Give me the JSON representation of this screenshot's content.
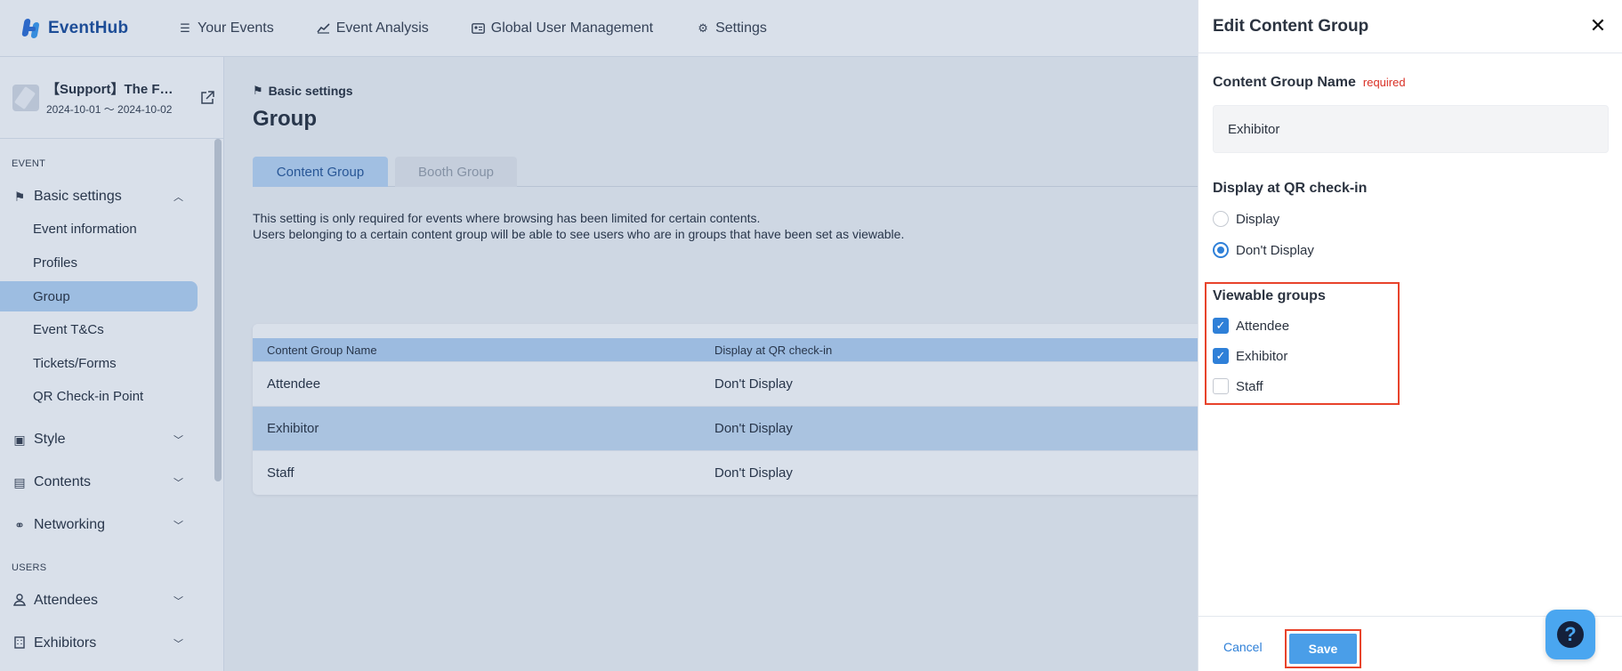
{
  "app": {
    "name": "EventHub"
  },
  "nav": [
    {
      "label": "Your Events",
      "icon": "list-icon"
    },
    {
      "label": "Event Analysis",
      "icon": "chart-line-icon"
    },
    {
      "label": "Global User Management",
      "icon": "id-card-icon"
    },
    {
      "label": "Settings",
      "icon": "gear-icon"
    }
  ],
  "event": {
    "name": "【Support】The F…",
    "dates": "2024-10-01 〜 2024-10-02"
  },
  "sidebar": {
    "section_event": "EVENT",
    "section_users": "USERS",
    "basic_settings": "Basic settings",
    "sub_items": [
      "Event information",
      "Profiles",
      "Group",
      "Event T&Cs",
      "Tickets/Forms",
      "QR Check-in Point"
    ],
    "active_sub": "Group",
    "style": "Style",
    "contents": "Contents",
    "networking": "Networking",
    "attendees": "Attendees",
    "exhibitors": "Exhibitors"
  },
  "main": {
    "breadcrumb": "Basic settings",
    "title": "Group",
    "tabs": {
      "content_group": "Content Group",
      "booth_group": "Booth Group"
    },
    "description_line1": "This setting is only required for events where browsing has been limited for certain contents.",
    "description_line2": "Users belonging to a certain content group will be able to see users who are in groups that have been set as viewable.",
    "table": {
      "headers": [
        "Content Group Name",
        "Display at QR check-in"
      ],
      "rows": [
        [
          "Attendee",
          "Don't Display"
        ],
        [
          "Exhibitor",
          "Don't Display"
        ],
        [
          "Staff",
          "Don't Display"
        ]
      ]
    }
  },
  "drawer": {
    "title": "Edit Content Group",
    "name_label": "Content Group Name",
    "required_label": "required",
    "name_value": "Exhibitor",
    "qr_label": "Display at QR check-in",
    "qr_options": [
      "Display",
      "Don't Display"
    ],
    "qr_selected": "Don't Display",
    "viewable_label": "Viewable groups",
    "viewable_options": [
      {
        "label": "Attendee",
        "checked": true
      },
      {
        "label": "Exhibitor",
        "checked": true
      },
      {
        "label": "Staff",
        "checked": false
      }
    ],
    "cancel_label": "Cancel",
    "save_label": "Save"
  },
  "colors": {
    "accent": "#2f80d8",
    "highlight": "#e8432b",
    "active_tab": "#bcd8f6"
  }
}
